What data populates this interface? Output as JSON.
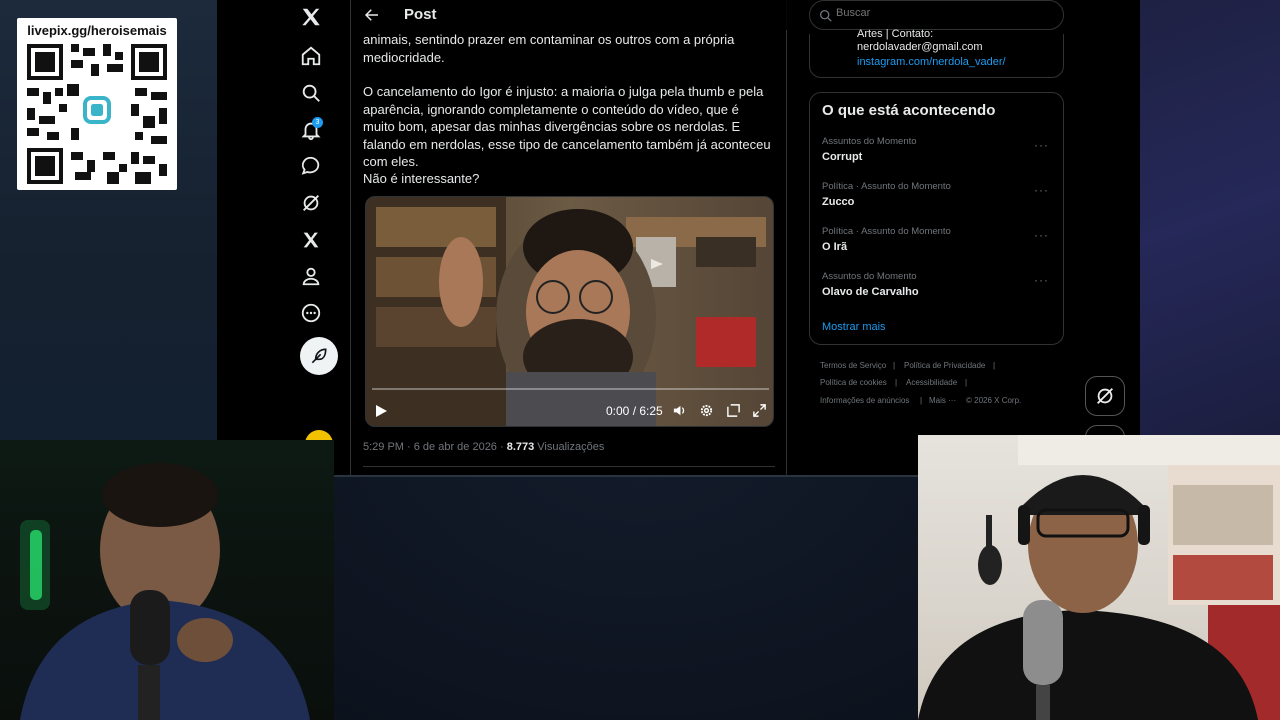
{
  "overlay": {
    "qr_caption": "livepix.gg/heroisemais"
  },
  "nav": {
    "notification_count": "3",
    "icons": [
      "x-logo-icon",
      "home-icon",
      "search-icon",
      "bell-icon",
      "message-icon",
      "grok-icon",
      "x-premium-icon",
      "profile-icon",
      "more-icon",
      "post-icon"
    ]
  },
  "post": {
    "header_title": "Post",
    "text_fragment": "animais, sentindo prazer em contaminar os outros com a própria mediocridade.",
    "paragraph_2": "O cancelamento do Igor é injusto: a maioria o julga pela thumb e pela aparência, ignorando completamente o conteúdo do vídeo, que é muito bom, apesar das minhas divergências sobre os nerdolas. E falando em nerdolas, esse tipo de cancelamento também já aconteceu com eles.",
    "paragraph_3": "Não é interessante?",
    "video": {
      "time": "0:00 / 6:25",
      "progress": 0
    },
    "timestamp": "5:29 PM · 6 de abr de 2026 · ",
    "views_count": "8.773",
    "views_label": " Visualizações"
  },
  "sidebar": {
    "search_placeholder": "Buscar",
    "profile_partial": "Artes | Contato:",
    "profile_email": "nerdolavader@gmail.com",
    "profile_link": "instagram.com/nerdola_vader/",
    "trends_title": "O que está acontecendo",
    "trends": [
      {
        "category": "Assuntos do Momento",
        "name": "Corrupt"
      },
      {
        "category": "Política · Assunto do Momento",
        "name": "Zucco"
      },
      {
        "category": "Política · Assunto do Momento",
        "name": "O Irã"
      },
      {
        "category": "Assuntos do Momento",
        "name": "Olavo de Carvalho"
      }
    ],
    "show_more": "Mostrar mais",
    "footer": {
      "terms": "Termos de Serviço",
      "privacy": "Política de Privacidade",
      "cookies": "Política de cookies",
      "accessibility": "Acessibilidade",
      "ads": "Informações de anúncios",
      "more": "Mais ···",
      "copyright": "© 2026 X Corp."
    }
  },
  "colors": {
    "accent": "#1d9bf0",
    "background": "#000000",
    "border": "#2f3336",
    "muted": "#71767b"
  }
}
